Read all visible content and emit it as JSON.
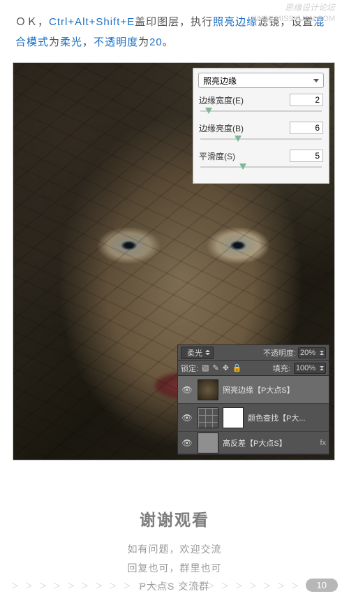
{
  "watermark": {
    "cn": "思缘设计论坛",
    "url": "WWW.MISSYUAN.COM"
  },
  "instruction": {
    "p1": "ＯＫ，",
    "p2": "Ctrl+Alt+Shift+E",
    "p3": "盖印图层，执行",
    "p4": "照亮边缘",
    "p5": "滤镜，设置",
    "p6": "混合模式",
    "p7": "为",
    "p8": "柔光",
    "p9": "，",
    "p10": "不透明度",
    "p11": "为",
    "p12": "20",
    "p13": "。"
  },
  "filter_panel": {
    "name": "照亮边缘",
    "edge_width": {
      "label": "边缘宽度(E)",
      "value": "2",
      "pos": "4%"
    },
    "edge_brightness": {
      "label": "边缘亮度(B)",
      "value": "6",
      "pos": "28%"
    },
    "smoothness": {
      "label": "平滑度(S)",
      "value": "5",
      "pos": "32%"
    }
  },
  "layers_panel": {
    "blend_mode": "柔光",
    "opacity_label": "不透明度:",
    "opacity_value": "20%",
    "lock_label": "锁定:",
    "fill_label": "填充:",
    "fill_value": "100%",
    "layers": [
      {
        "name": "照亮边缘【P大点S】"
      },
      {
        "name": "颜色查找【P大..."
      },
      {
        "name": "高反差【P大点S】"
      }
    ]
  },
  "footer": {
    "thanks": "谢谢观看",
    "line1": "如有问题，欢迎交流",
    "line2": "回复也可，群里也可",
    "line3": "P大点S 交流群"
  },
  "bottom": {
    "chevrons": "＞ ＞ ＞ ＞ ＞ ＞ ＞ ＞ ＞ ＞ ＞ ＞ ＞ ＞ ＞ ＞ ＞ ＞ ＞ ＞ ＞",
    "page": "10"
  }
}
